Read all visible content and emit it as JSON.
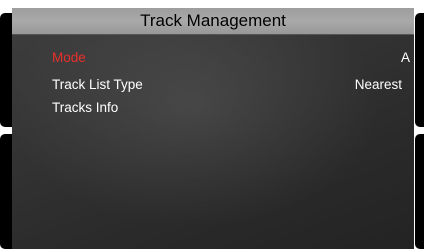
{
  "header": {
    "title": "Track Management"
  },
  "menu": {
    "items": [
      {
        "label": "Mode",
        "value": "A",
        "selected": true
      },
      {
        "label": "Track List Type",
        "value": "Nearest",
        "selected": false
      },
      {
        "label": "Tracks Info",
        "value": "",
        "selected": false
      }
    ]
  },
  "colors": {
    "selected_text": "#e8302a",
    "normal_text": "#ffffff",
    "title_bar": "#a3a3a3"
  }
}
